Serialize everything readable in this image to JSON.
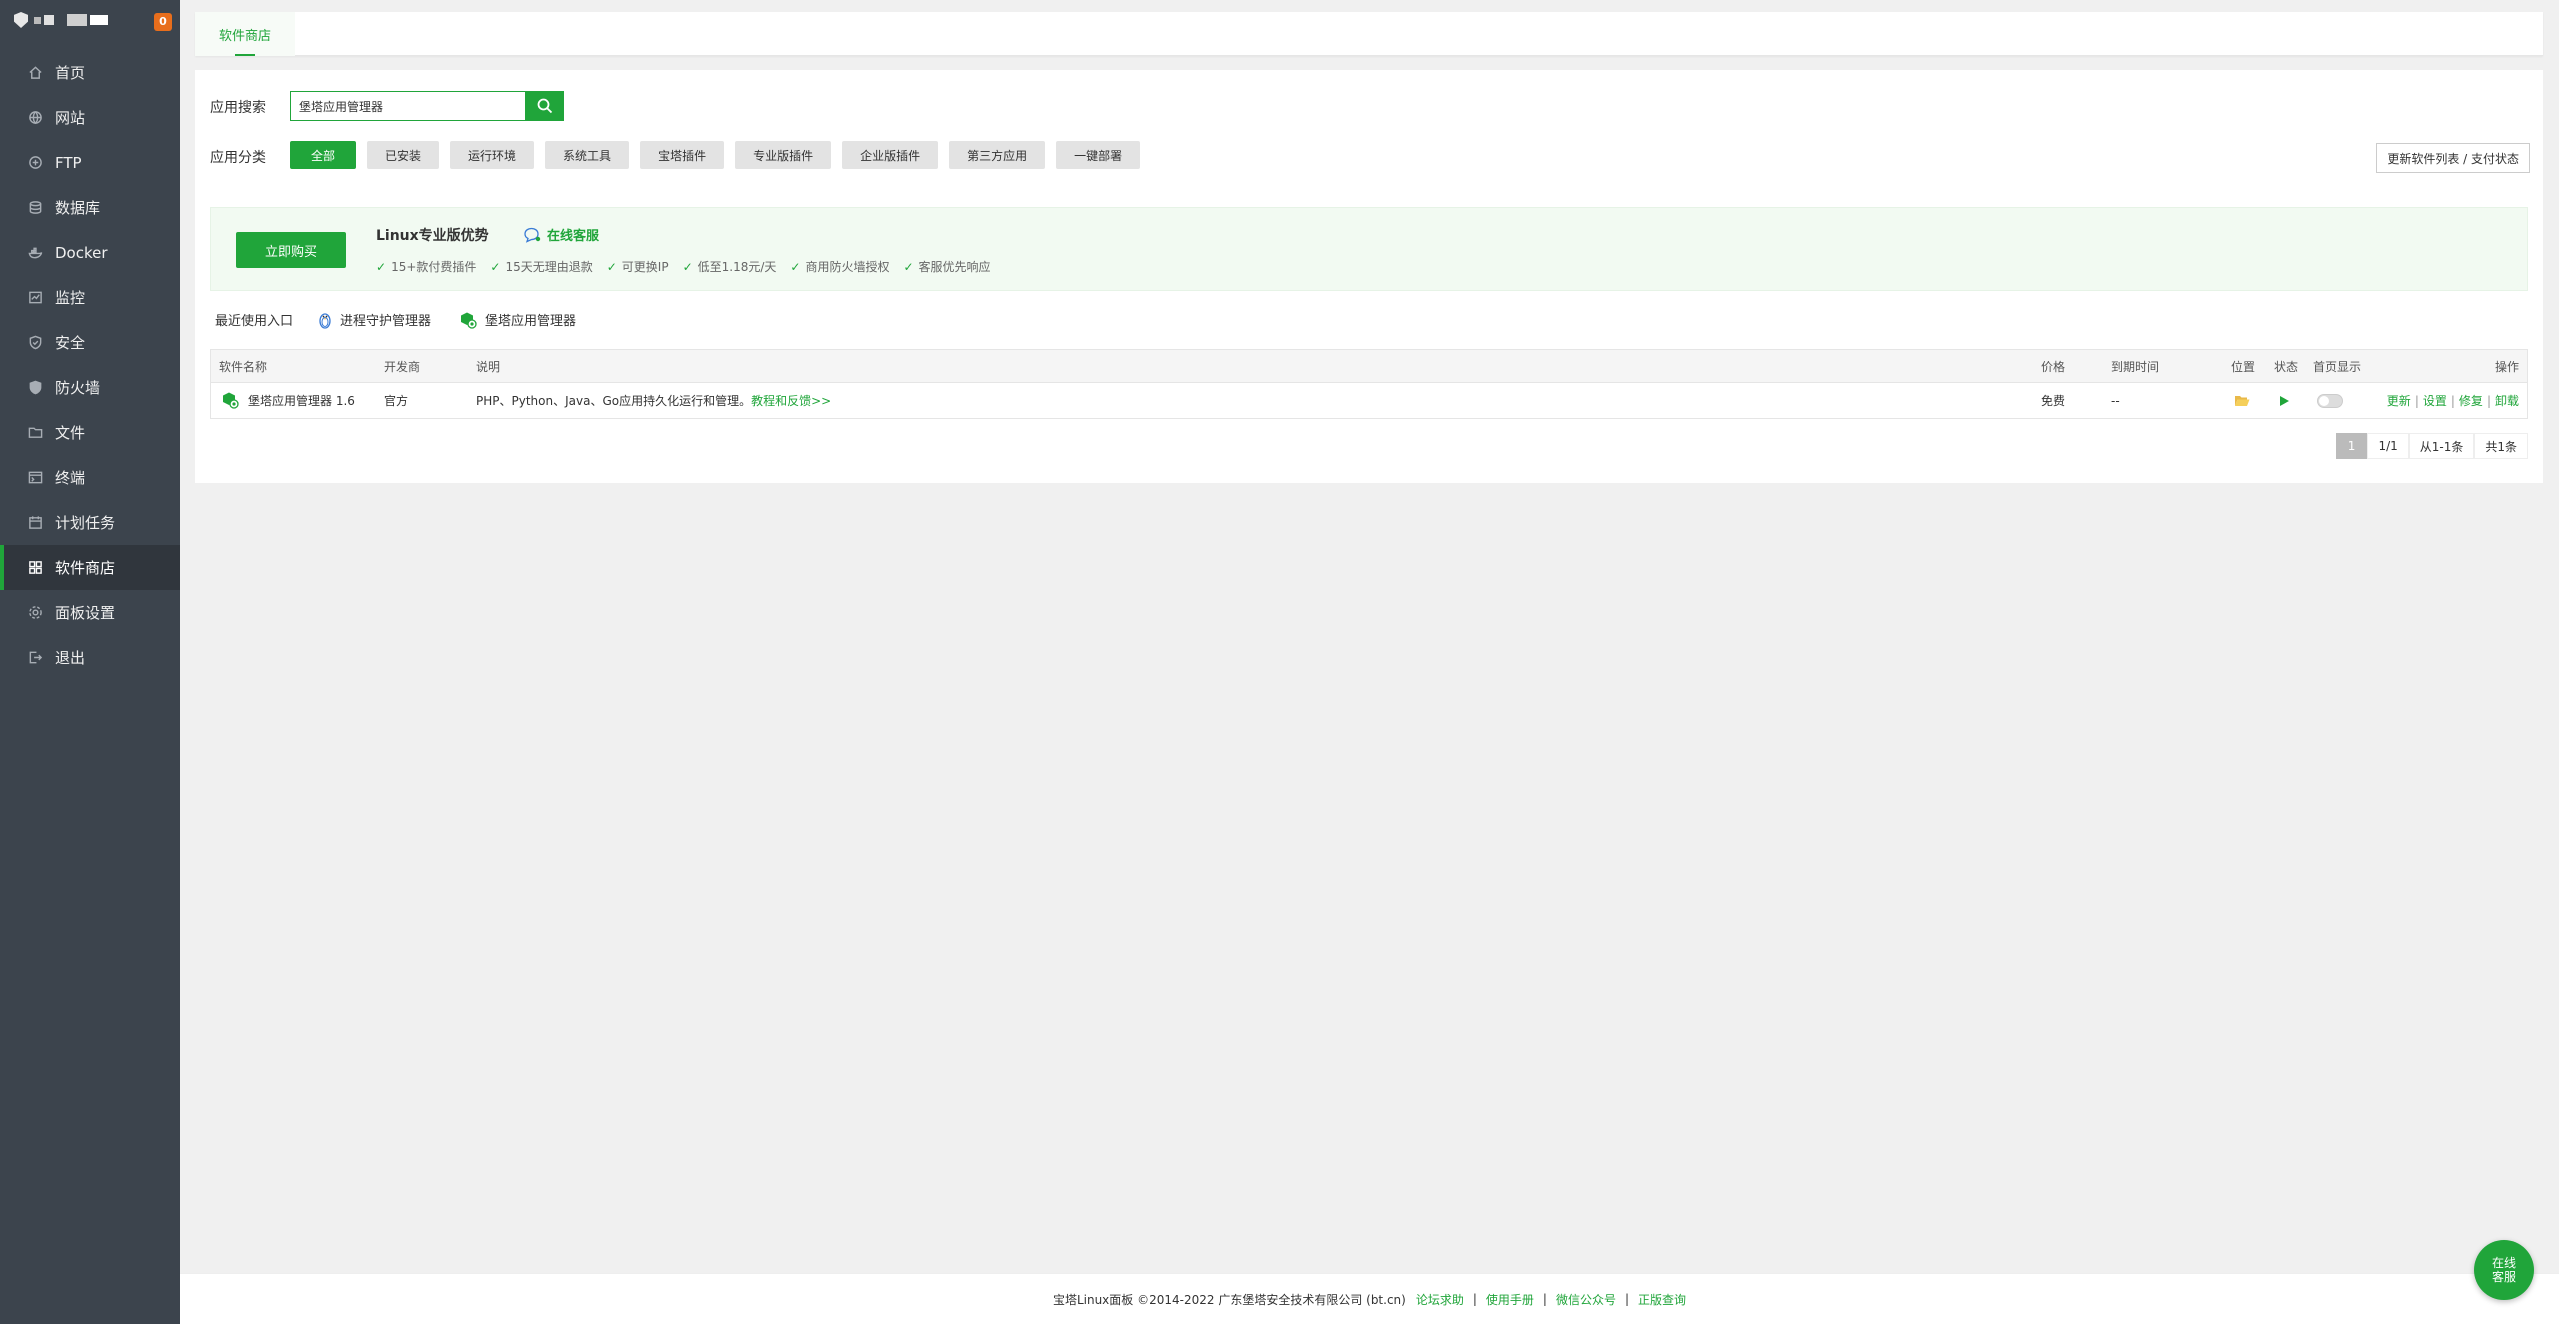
{
  "sidebar": {
    "badge": "0",
    "items": [
      {
        "label": "首页",
        "icon": "home-icon"
      },
      {
        "label": "网站",
        "icon": "globe-icon"
      },
      {
        "label": "FTP",
        "icon": "ftp-icon"
      },
      {
        "label": "数据库",
        "icon": "database-icon"
      },
      {
        "label": "Docker",
        "icon": "docker-icon"
      },
      {
        "label": "监控",
        "icon": "monitor-icon"
      },
      {
        "label": "安全",
        "icon": "shield-check-icon"
      },
      {
        "label": "防火墙",
        "icon": "firewall-icon"
      },
      {
        "label": "文件",
        "icon": "folder-icon"
      },
      {
        "label": "终端",
        "icon": "terminal-icon"
      },
      {
        "label": "计划任务",
        "icon": "calendar-icon"
      },
      {
        "label": "软件商店",
        "icon": "grid-icon",
        "active": true
      },
      {
        "label": "面板设置",
        "icon": "gear-icon"
      },
      {
        "label": "退出",
        "icon": "logout-icon"
      }
    ]
  },
  "tabbar": {
    "tab": "软件商店"
  },
  "search": {
    "label": "应用搜索",
    "value": "堡塔应用管理器"
  },
  "category": {
    "label": "应用分类",
    "items": [
      "全部",
      "已安装",
      "运行环境",
      "系统工具",
      "宝塔插件",
      "专业版插件",
      "企业版插件",
      "第三方应用",
      "一键部署"
    ],
    "active": "全部"
  },
  "update_button": "更新软件列表 / 支付状态",
  "promo": {
    "buy": "立即购买",
    "title": "Linux专业版优势",
    "service": "在线客服",
    "features": [
      "15+款付费插件",
      "15天无理由退款",
      "可更换IP",
      "低至1.18元/天",
      "商用防火墙授权",
      "客服优先响应"
    ]
  },
  "recent": {
    "label": "最近使用入口",
    "items": [
      "进程守护管理器",
      "堡塔应用管理器"
    ]
  },
  "table": {
    "headers": {
      "name": "软件名称",
      "dev": "开发商",
      "desc": "说明",
      "price": "价格",
      "expire": "到期时间",
      "location": "位置",
      "status": "状态",
      "home": "首页显示",
      "ops": "操作"
    },
    "rows": [
      {
        "name": "堡塔应用管理器 1.6",
        "dev": "官方",
        "desc": "PHP、Python、Java、Go应用持久化运行和管理。",
        "desc_link": "教程和反馈>>",
        "price": "免费",
        "expire": "--",
        "ops": [
          "更新",
          "设置",
          "修复",
          "卸载"
        ]
      }
    ]
  },
  "pager": {
    "current": "1",
    "pages": "1/1",
    "range": "从1-1条",
    "total": "共1条"
  },
  "footer": {
    "copyright": "宝塔Linux面板 ©2014-2022 广东堡塔安全技术有限公司 (bt.cn)",
    "links": [
      "论坛求助",
      "使用手册",
      "微信公众号",
      "正版查询"
    ]
  },
  "float_service": {
    "line1": "在线",
    "line2": "客服"
  },
  "colors": {
    "accent": "#20a53a",
    "sidebar": "#3c444d",
    "sidebar_active": "#30363d",
    "badge": "#e86e1c"
  }
}
